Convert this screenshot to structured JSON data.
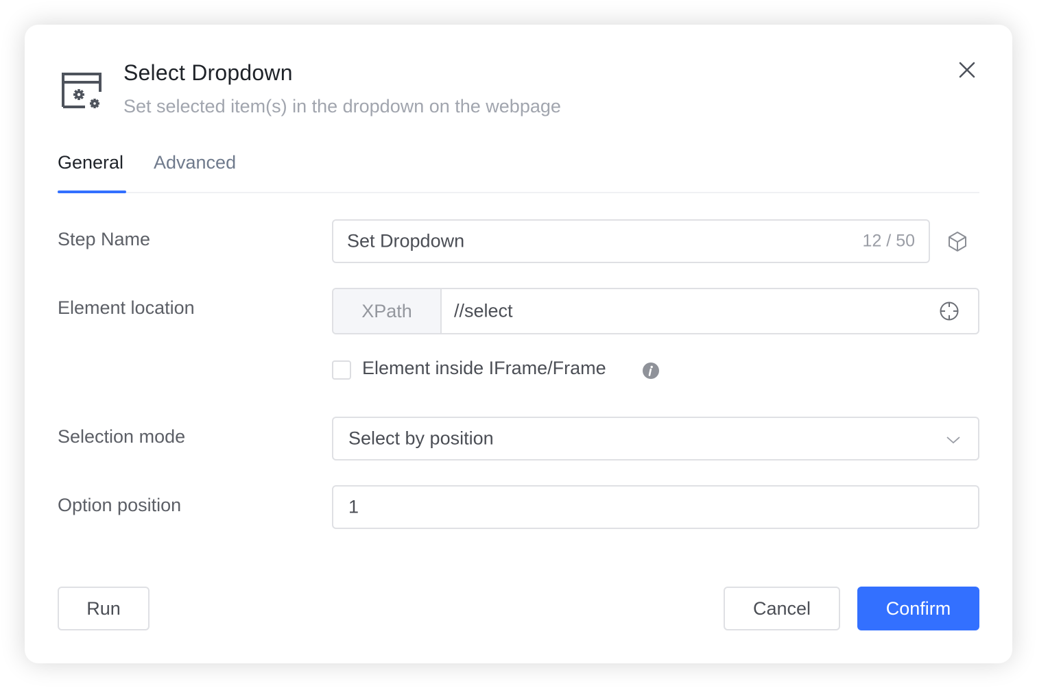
{
  "dialog": {
    "title": "Select Dropdown",
    "subtitle": "Set selected item(s) in the dropdown on the webpage",
    "header_icon": "browser-gears-icon",
    "close_icon": "close-icon"
  },
  "tabs": [
    {
      "label": "General",
      "active": true
    },
    {
      "label": "Advanced",
      "active": false
    }
  ],
  "form": {
    "step_name": {
      "label": "Step Name",
      "value": "Set Dropdown",
      "counter": "12 / 50",
      "side_icon": "cube-icon"
    },
    "element_location": {
      "label": "Element location",
      "addon": "XPath",
      "value": "//select",
      "side_icon": "crosshair-icon"
    },
    "iframe_checkbox": {
      "label": "Element inside IFrame/Frame",
      "checked": false,
      "info_icon": "info-icon"
    },
    "selection_mode": {
      "label": "Selection mode",
      "value": "Select by position",
      "icon": "chevron-down-icon"
    },
    "option_position": {
      "label": "Option position",
      "value": "1"
    }
  },
  "footer": {
    "run_label": "Run",
    "cancel_label": "Cancel",
    "confirm_label": "Confirm"
  },
  "colors": {
    "primary": "#3370ff",
    "title": "#1f2329",
    "subtitle": "#a1a5ae",
    "tab_inactive": "#6f7a8c"
  }
}
